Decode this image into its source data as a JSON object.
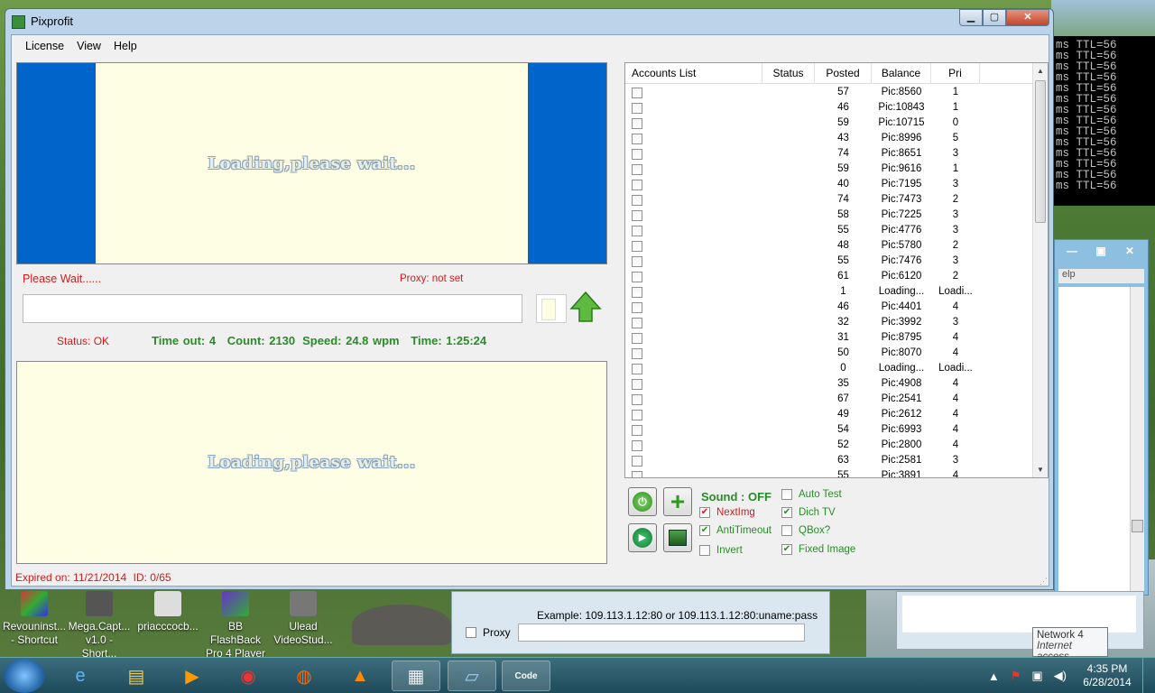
{
  "window": {
    "title": "Pixprofit",
    "menu": [
      "License",
      "View",
      "Help"
    ]
  },
  "captcha": {
    "loading_text": "Loading,please wait..."
  },
  "left_panel": {
    "please_wait": "Please Wait......",
    "proxy": "Proxy: not set",
    "status": "Status: OK",
    "timeout": "Time out: 4",
    "count": "Count: 2130",
    "speed": "Speed: 24.8 wpm",
    "time": "Time: 1:25:24"
  },
  "accounts": {
    "headers": [
      "Accounts List",
      "Status",
      "Posted",
      "Balance",
      "Pri"
    ],
    "rows": [
      {
        "posted": "57",
        "balance": "Pic:8560",
        "pri": "1"
      },
      {
        "posted": "46",
        "balance": "Pic:10843",
        "pri": "1"
      },
      {
        "posted": "59",
        "balance": "Pic:10715",
        "pri": "0"
      },
      {
        "posted": "43",
        "balance": "Pic:8996",
        "pri": "5"
      },
      {
        "posted": "74",
        "balance": "Pic:8651",
        "pri": "3"
      },
      {
        "posted": "59",
        "balance": "Pic:9616",
        "pri": "1"
      },
      {
        "posted": "40",
        "balance": "Pic:7195",
        "pri": "3"
      },
      {
        "posted": "74",
        "balance": "Pic:7473",
        "pri": "2"
      },
      {
        "posted": "58",
        "balance": "Pic:7225",
        "pri": "3"
      },
      {
        "posted": "55",
        "balance": "Pic:4776",
        "pri": "3"
      },
      {
        "posted": "48",
        "balance": "Pic:5780",
        "pri": "2"
      },
      {
        "posted": "55",
        "balance": "Pic:7476",
        "pri": "3"
      },
      {
        "posted": "61",
        "balance": "Pic:6120",
        "pri": "2"
      },
      {
        "posted": "1",
        "balance": "Loading...",
        "pri": "Loadi..."
      },
      {
        "posted": "46",
        "balance": "Pic:4401",
        "pri": "4"
      },
      {
        "posted": "32",
        "balance": "Pic:3992",
        "pri": "3"
      },
      {
        "posted": "31",
        "balance": "Pic:8795",
        "pri": "4"
      },
      {
        "posted": "50",
        "balance": "Pic:8070",
        "pri": "4"
      },
      {
        "posted": "0",
        "balance": "Loading...",
        "pri": "Loadi..."
      },
      {
        "posted": "35",
        "balance": "Pic:4908",
        "pri": "4"
      },
      {
        "posted": "67",
        "balance": "Pic:2541",
        "pri": "4"
      },
      {
        "posted": "49",
        "balance": "Pic:2612",
        "pri": "4"
      },
      {
        "posted": "54",
        "balance": "Pic:6993",
        "pri": "4"
      },
      {
        "posted": "52",
        "balance": "Pic:2800",
        "pri": "4"
      },
      {
        "posted": "63",
        "balance": "Pic:2581",
        "pri": "3"
      },
      {
        "posted": "55",
        "balance": "Pic:3891",
        "pri": "4"
      }
    ]
  },
  "controls": {
    "sound": "Sound : OFF",
    "options": [
      {
        "label": "NextImg",
        "checked": true
      },
      {
        "label": "AntiTimeout",
        "checked": true
      },
      {
        "label": "Invert",
        "checked": false
      },
      {
        "label": "Auto Test",
        "checked": false
      },
      {
        "label": "Dich TV",
        "checked": true
      },
      {
        "label": "QBox?",
        "checked": false
      },
      {
        "label": "Fixed Image",
        "checked": true
      }
    ]
  },
  "statusbar": {
    "expired": "Expired on: 11/21/2014",
    "id": "ID: 0/65"
  },
  "cmd": {
    "line": "ms TTL=56"
  },
  "win2_menu": "elp",
  "proxy_window": {
    "example": "Example: 109.113.1.12:80 or 109.113.1.12:80:uname:pass",
    "proxy_label": "Proxy"
  },
  "tooltip": {
    "title": "Network  4",
    "subtitle": "Internet access"
  },
  "desktop_icons": [
    {
      "line1": "Revouninst...",
      "line2": "- Shortcut"
    },
    {
      "line1": "Mega.Capt...",
      "line2": "v1.0 - Short..."
    },
    {
      "line1": "priacccocb...",
      "line2": ""
    },
    {
      "line1": "BB FlashBack",
      "line2": "Pro 4 Player"
    },
    {
      "line1": "Ulead",
      "line2": "VideoStud..."
    }
  ],
  "taskbar": {
    "time": "4:35 PM",
    "date": "6/28/2014",
    "code_label": "Code"
  }
}
